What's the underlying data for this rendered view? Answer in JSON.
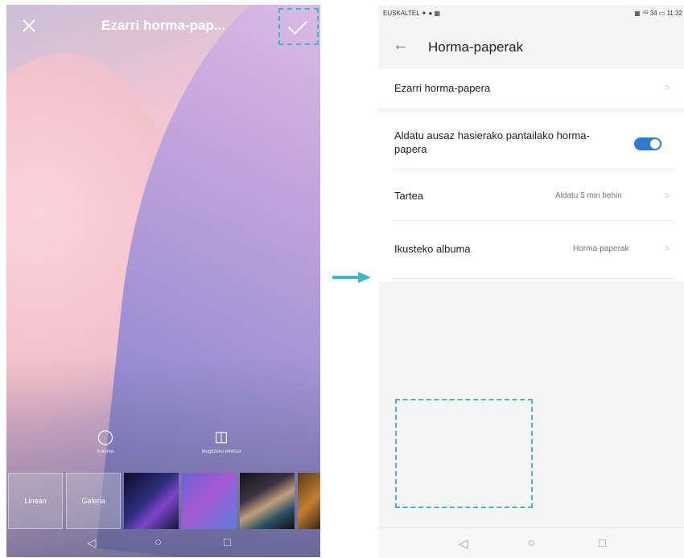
{
  "left_screen": {
    "title": "Ezarri horma-pap...",
    "tools": [
      {
        "icon": "droplet-icon",
        "glyph": "💧",
        "label": "Kolorea"
      },
      {
        "icon": "grid-icon",
        "glyph": "◫",
        "label": "Mugitzeko efektua"
      }
    ],
    "thumbnails": [
      "Linean",
      "Galeria"
    ]
  },
  "right_screen": {
    "status": {
      "carrier": "EUSKALTEL ✦ ● ▦",
      "right": "▦ ⁴ᴳ 34 ▭ 11:32"
    },
    "title": "Horma-paperak",
    "items": [
      {
        "label": "Ezarri horma-papera"
      },
      {
        "label": "Aldatu ausaz hasierako pantailako horma-papera",
        "toggle": true
      },
      {
        "label": "Tartea",
        "value": "Aldatu 5 min behin"
      },
      {
        "label": "Ikusteko albuma",
        "value": "Horma-paperak"
      }
    ]
  },
  "navbar": {
    "back": "◁",
    "home": "○",
    "recent": "□"
  },
  "colors": {
    "accent": "#2c7cd5",
    "highlight": "#3cb9c3"
  }
}
